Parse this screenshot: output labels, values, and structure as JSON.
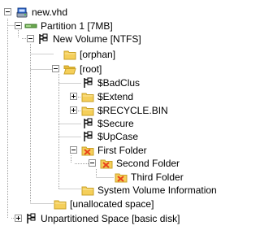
{
  "tree": {
    "nodes": [
      {
        "id": "new-vhd",
        "label": "new.vhd",
        "icon": "virtual-disk-icon",
        "expander": "expanded"
      },
      {
        "id": "partition-1",
        "label": "Partition 1 [7MB]",
        "icon": "partition-icon",
        "expander": "expanded"
      },
      {
        "id": "new-volume",
        "label": "New Volume [NTFS]",
        "icon": "volume-icon",
        "expander": "expanded"
      },
      {
        "id": "orphan",
        "label": "[orphan]",
        "icon": "folder-icon",
        "expander": "none"
      },
      {
        "id": "root",
        "label": "[root]",
        "icon": "folder-open-icon",
        "expander": "expanded"
      },
      {
        "id": "badclus",
        "label": "$BadClus",
        "icon": "system-file-icon",
        "expander": "none"
      },
      {
        "id": "extend",
        "label": "$Extend",
        "icon": "folder-icon",
        "expander": "collapsed"
      },
      {
        "id": "recycle-bin",
        "label": "$RECYCLE.BIN",
        "icon": "folder-icon",
        "expander": "collapsed"
      },
      {
        "id": "secure",
        "label": "$Secure",
        "icon": "system-file-icon",
        "expander": "none"
      },
      {
        "id": "upcase",
        "label": "$UpCase",
        "icon": "system-file-icon",
        "expander": "none"
      },
      {
        "id": "first-folder",
        "label": "First Folder",
        "icon": "deleted-folder-icon",
        "expander": "expanded"
      },
      {
        "id": "second-folder",
        "label": "Second Folder",
        "icon": "deleted-folder-icon",
        "expander": "expanded"
      },
      {
        "id": "third-folder",
        "label": "Third Folder",
        "icon": "deleted-folder-icon",
        "expander": "none"
      },
      {
        "id": "system-volume-information",
        "label": "System Volume Information",
        "icon": "folder-icon",
        "expander": "none"
      },
      {
        "id": "unallocated-space",
        "label": "[unallocated space]",
        "icon": "folder-icon",
        "expander": "none"
      },
      {
        "id": "unpartitioned-space",
        "label": "Unpartitioned Space [basic disk]",
        "icon": "volume-icon",
        "expander": "collapsed"
      }
    ]
  },
  "colors": {
    "folder": "#f5cf5a",
    "folder_dark": "#c9a227",
    "deleted_x": "#e8431b",
    "partition": "#6aa84f",
    "guide_line": "#a0a0a0",
    "disk_blue": "#2d6bd6"
  }
}
